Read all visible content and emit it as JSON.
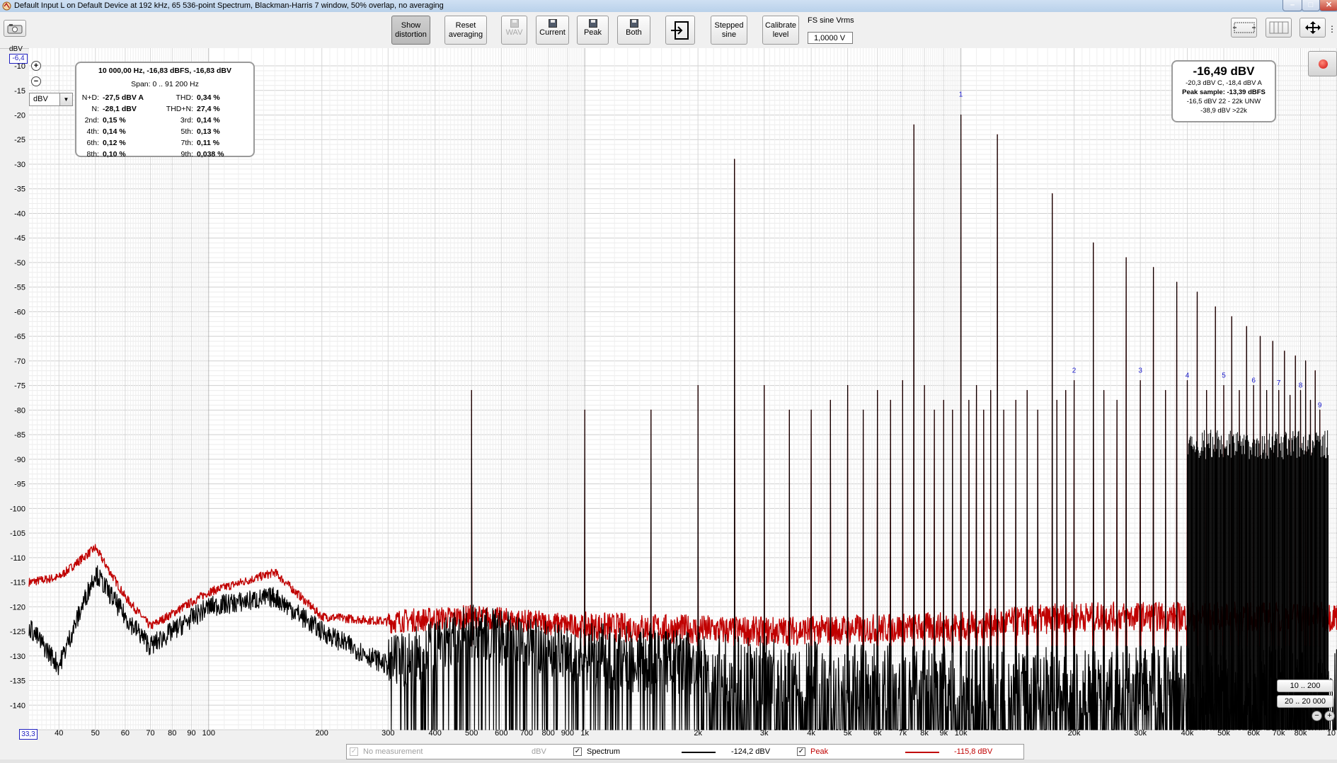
{
  "window": {
    "title": "Default Input L on Default Device at 192 kHz, 65 536-point Spectrum, Blackman-Harris 7 window, 50% overlap, no averaging"
  },
  "toolbar": {
    "buttons": [
      {
        "id": "show-distortion",
        "label1": "Show",
        "label2": "distortion",
        "state": "pressed"
      },
      {
        "id": "reset-averaging",
        "label1": "Reset",
        "label2": "averaging"
      },
      {
        "id": "save-wav",
        "label1": "WAV",
        "state": "disabled",
        "icon": "floppy-icon"
      },
      {
        "id": "save-current",
        "label1": "Current",
        "icon": "floppy-icon"
      },
      {
        "id": "save-peak",
        "label1": "Peak",
        "icon": "floppy-icon"
      },
      {
        "id": "save-both",
        "label1": "Both",
        "icon": "floppy-icon"
      },
      {
        "id": "import",
        "label1": "",
        "icon": "import-icon"
      },
      {
        "id": "stepped-sine",
        "label1": "Stepped",
        "label2": "sine"
      },
      {
        "id": "calibrate-level",
        "label1": "Calibrate",
        "label2": "level"
      }
    ],
    "fs_label": "FS sine Vrms",
    "fs_value": "1,0000 V"
  },
  "plot": {
    "y_unit_label": "dBV",
    "y_top_value": "-6,4",
    "x_left_value": "33,3",
    "unit_select": "dBV",
    "y_ticks": [
      "-10",
      "-15",
      "-20",
      "-25",
      "-30",
      "-35",
      "-40",
      "-45",
      "-50",
      "-55",
      "-60",
      "-65",
      "-70",
      "-75",
      "-80",
      "-85",
      "-90",
      "-95",
      "-100",
      "-105",
      "-110",
      "-115",
      "-120",
      "-125",
      "-130",
      "-135",
      "-140"
    ],
    "x_ticks": [
      "40",
      "50",
      "60",
      "70",
      "80",
      "90",
      "100",
      "200",
      "300",
      "400",
      "500",
      "600",
      "700",
      "800",
      "900",
      "1k",
      "2k",
      "3k",
      "4k",
      "5k",
      "6k",
      "7k",
      "8k",
      "9k",
      "10k",
      "20k",
      "30k",
      "40k",
      "50k",
      "60k",
      "70k",
      "80k",
      "10"
    ]
  },
  "distortion_panel": {
    "header": "10 000,00 Hz, -16,83 dBFS, -16,83 dBV",
    "span": "Span: 0 .. 91 200 Hz",
    "rows": [
      {
        "l_label": "N+D:",
        "l_value": "-27,5 dBV A",
        "r_label": "THD:",
        "r_value": "0,34 %"
      },
      {
        "l_label": "N:",
        "l_value": "-28,1 dBV",
        "r_label": "THD+N:",
        "r_value": "27,4 %"
      },
      {
        "l_label": "2nd:",
        "l_value": "0,15 %",
        "r_label": "3rd:",
        "r_value": "0,14 %"
      },
      {
        "l_label": "4th:",
        "l_value": "0,14 %",
        "r_label": "5th:",
        "r_value": "0,13 %"
      },
      {
        "l_label": "6th:",
        "l_value": "0,12 %",
        "r_label": "7th:",
        "r_value": "0,11 %"
      },
      {
        "l_label": "8th:",
        "l_value": "0,10 %",
        "r_label": "9th:",
        "r_value": "0,038 %"
      }
    ]
  },
  "level_panel": {
    "main": "-16,49 dBV",
    "lines": [
      "-20,3 dBV C, -18,4 dBV A",
      "Peak sample: -13,39 dBFS",
      "-16,5 dBV 22 - 22k UNW",
      "-38,9 dBV >22k"
    ]
  },
  "range_buttons": [
    "10 .. 200",
    "20 .. 20 000"
  ],
  "legend": {
    "no_measurement": "No measurement",
    "no_measurement_unit": "dBV",
    "spectrum_label": "Spectrum",
    "spectrum_value": "-124,2 dBV",
    "peak_label": "Peak",
    "peak_value": "-115,8 dBV"
  },
  "colors": {
    "spectrum": "#000000",
    "peak": "#c00000",
    "harmonic_marker": "#1a1acc",
    "grid": "#d2d2d2"
  },
  "chart_data": {
    "type": "line",
    "xlabel": "",
    "ylabel": "dBV",
    "x_scale": "log",
    "xlim": [
      33.3,
      100000
    ],
    "ylim": [
      -145,
      -6.4
    ],
    "grid": true,
    "legend": "bottom",
    "series": [
      {
        "name": "Spectrum",
        "noise_floor": [
          [
            33.3,
            -124
          ],
          [
            40,
            -132
          ],
          [
            50,
            -113
          ],
          [
            60,
            -122
          ],
          [
            70,
            -128
          ],
          [
            100,
            -120
          ],
          [
            150,
            -118
          ],
          [
            200,
            -125
          ],
          [
            300,
            -132
          ],
          [
            500,
            -125
          ],
          [
            1000,
            -130
          ],
          [
            3000,
            -133
          ],
          [
            10000,
            -135
          ]
        ]
      },
      {
        "name": "Peak",
        "noise_floor": [
          [
            33.3,
            -115
          ],
          [
            40,
            -114
          ],
          [
            50,
            -108
          ],
          [
            60,
            -118
          ],
          [
            70,
            -124
          ],
          [
            100,
            -117
          ],
          [
            150,
            -113
          ],
          [
            200,
            -122
          ],
          [
            300,
            -123
          ],
          [
            500,
            -122
          ],
          [
            1000,
            -124
          ],
          [
            3000,
            -125
          ],
          [
            10000,
            -124
          ],
          [
            20000,
            -122
          ]
        ]
      }
    ],
    "spikes": [
      [
        500,
        -76
      ],
      [
        1000,
        -80
      ],
      [
        1500,
        -80
      ],
      [
        2000,
        -75
      ],
      [
        2500,
        -29
      ],
      [
        3000,
        -75
      ],
      [
        3500,
        -80
      ],
      [
        4000,
        -80
      ],
      [
        4500,
        -78
      ],
      [
        5000,
        -75
      ],
      [
        5500,
        -80
      ],
      [
        6000,
        -76
      ],
      [
        6500,
        -78
      ],
      [
        7000,
        -74
      ],
      [
        7500,
        -22
      ],
      [
        8000,
        -75
      ],
      [
        8500,
        -80
      ],
      [
        9000,
        -78
      ],
      [
        9500,
        -80
      ],
      [
        10000,
        -20
      ],
      [
        10500,
        -78
      ],
      [
        11000,
        -75
      ],
      [
        11500,
        -80
      ],
      [
        12000,
        -76
      ],
      [
        12500,
        -24
      ],
      [
        13000,
        -80
      ],
      [
        14000,
        -78
      ],
      [
        15000,
        -76
      ],
      [
        16000,
        -80
      ],
      [
        17500,
        -36
      ],
      [
        18000,
        -78
      ],
      [
        19000,
        -76
      ],
      [
        20000,
        -74
      ],
      [
        22500,
        -46
      ],
      [
        24000,
        -76
      ],
      [
        26000,
        -78
      ],
      [
        27500,
        -49
      ],
      [
        30000,
        -74
      ],
      [
        32500,
        -51
      ],
      [
        35000,
        -76
      ],
      [
        37500,
        -54
      ],
      [
        40000,
        -74
      ],
      [
        42500,
        -56
      ],
      [
        45000,
        -76
      ],
      [
        47500,
        -59
      ],
      [
        50000,
        -75
      ],
      [
        52500,
        -61
      ],
      [
        55000,
        -76
      ],
      [
        57500,
        -63
      ],
      [
        60000,
        -75
      ],
      [
        62500,
        -65
      ],
      [
        65000,
        -76
      ],
      [
        67500,
        -66
      ],
      [
        70000,
        -76
      ],
      [
        72500,
        -68
      ],
      [
        75000,
        -77
      ],
      [
        77500,
        -69
      ],
      [
        80000,
        -76
      ],
      [
        82500,
        -70
      ],
      [
        85000,
        -78
      ],
      [
        87500,
        -72
      ],
      [
        90000,
        -80
      ]
    ],
    "harmonic_markers": [
      {
        "label": "1",
        "x": 10000,
        "y": -16.8
      },
      {
        "label": "2",
        "x": 20000,
        "y": -73
      },
      {
        "label": "3",
        "x": 30000,
        "y": -73
      },
      {
        "label": "4",
        "x": 40000,
        "y": -74
      },
      {
        "label": "5",
        "x": 50000,
        "y": -74
      },
      {
        "label": "6",
        "x": 60000,
        "y": -75
      },
      {
        "label": "7",
        "x": 70000,
        "y": -75.5
      },
      {
        "label": "8",
        "x": 80000,
        "y": -76
      },
      {
        "label": "9",
        "x": 90000,
        "y": -80
      }
    ]
  }
}
